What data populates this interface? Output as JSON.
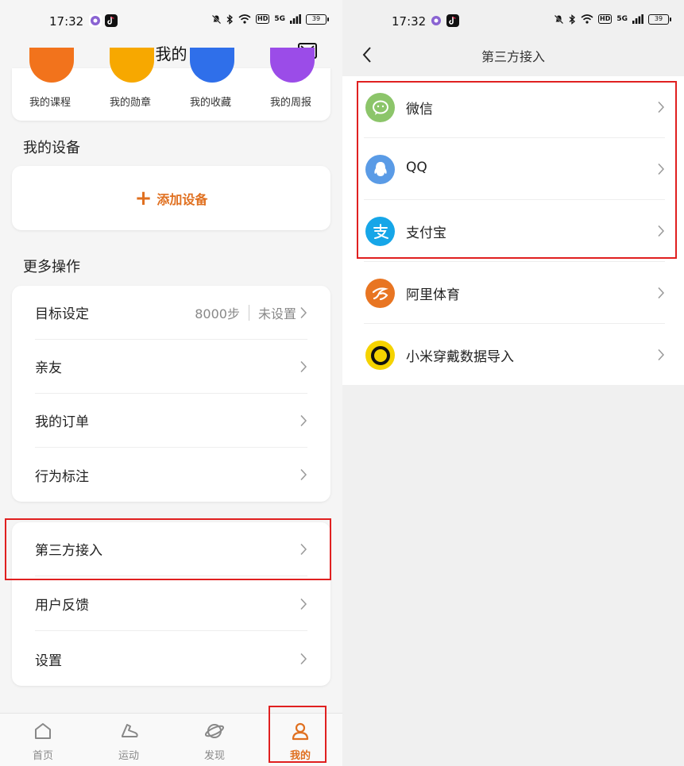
{
  "colors": {
    "accent": "#e07020",
    "highlight_box": "#e02020",
    "wechat": "#8cc56a",
    "qq": "#5a9be6",
    "alipay": "#16a6e8",
    "ali_sports": "#e87522",
    "xiaomi": "#f5d300"
  },
  "left": {
    "status": {
      "time": "17:32",
      "battery": "39",
      "network": "5G"
    },
    "title": "我的",
    "shortcuts": [
      {
        "label": "我的课程",
        "color": "#f2731c"
      },
      {
        "label": "我的勋章",
        "color": "#f7a800"
      },
      {
        "label": "我的收藏",
        "color": "#2f6fea"
      },
      {
        "label": "我的周报",
        "color": "#9b4ce8"
      }
    ],
    "devices": {
      "title": "我的设备",
      "add_label": "添加设备"
    },
    "more": {
      "title": "更多操作",
      "goal": {
        "label": "目标设定",
        "value": "8000步",
        "value2": "未设置"
      },
      "items": [
        "亲友",
        "我的订单",
        "行为标注"
      ]
    },
    "menu2": {
      "items": [
        "第三方接入",
        "用户反馈",
        "设置"
      ]
    },
    "tabs": [
      {
        "label": "首页",
        "icon": "home-icon"
      },
      {
        "label": "运动",
        "icon": "shoe-icon"
      },
      {
        "label": "发现",
        "icon": "planet-icon"
      },
      {
        "label": "我的",
        "icon": "user-icon"
      }
    ]
  },
  "right": {
    "status": {
      "time": "17:32",
      "battery": "39",
      "network": "5G"
    },
    "title": "第三方接入",
    "items": [
      {
        "label": "微信",
        "icon": "wechat-icon"
      },
      {
        "label": "QQ",
        "icon": "qq-icon"
      },
      {
        "label": "支付宝",
        "icon": "alipay-icon"
      },
      {
        "label": "阿里体育",
        "icon": "ali-sports-icon"
      },
      {
        "label": "小米穿戴数据导入",
        "icon": "xiaomi-wear-icon"
      }
    ]
  }
}
